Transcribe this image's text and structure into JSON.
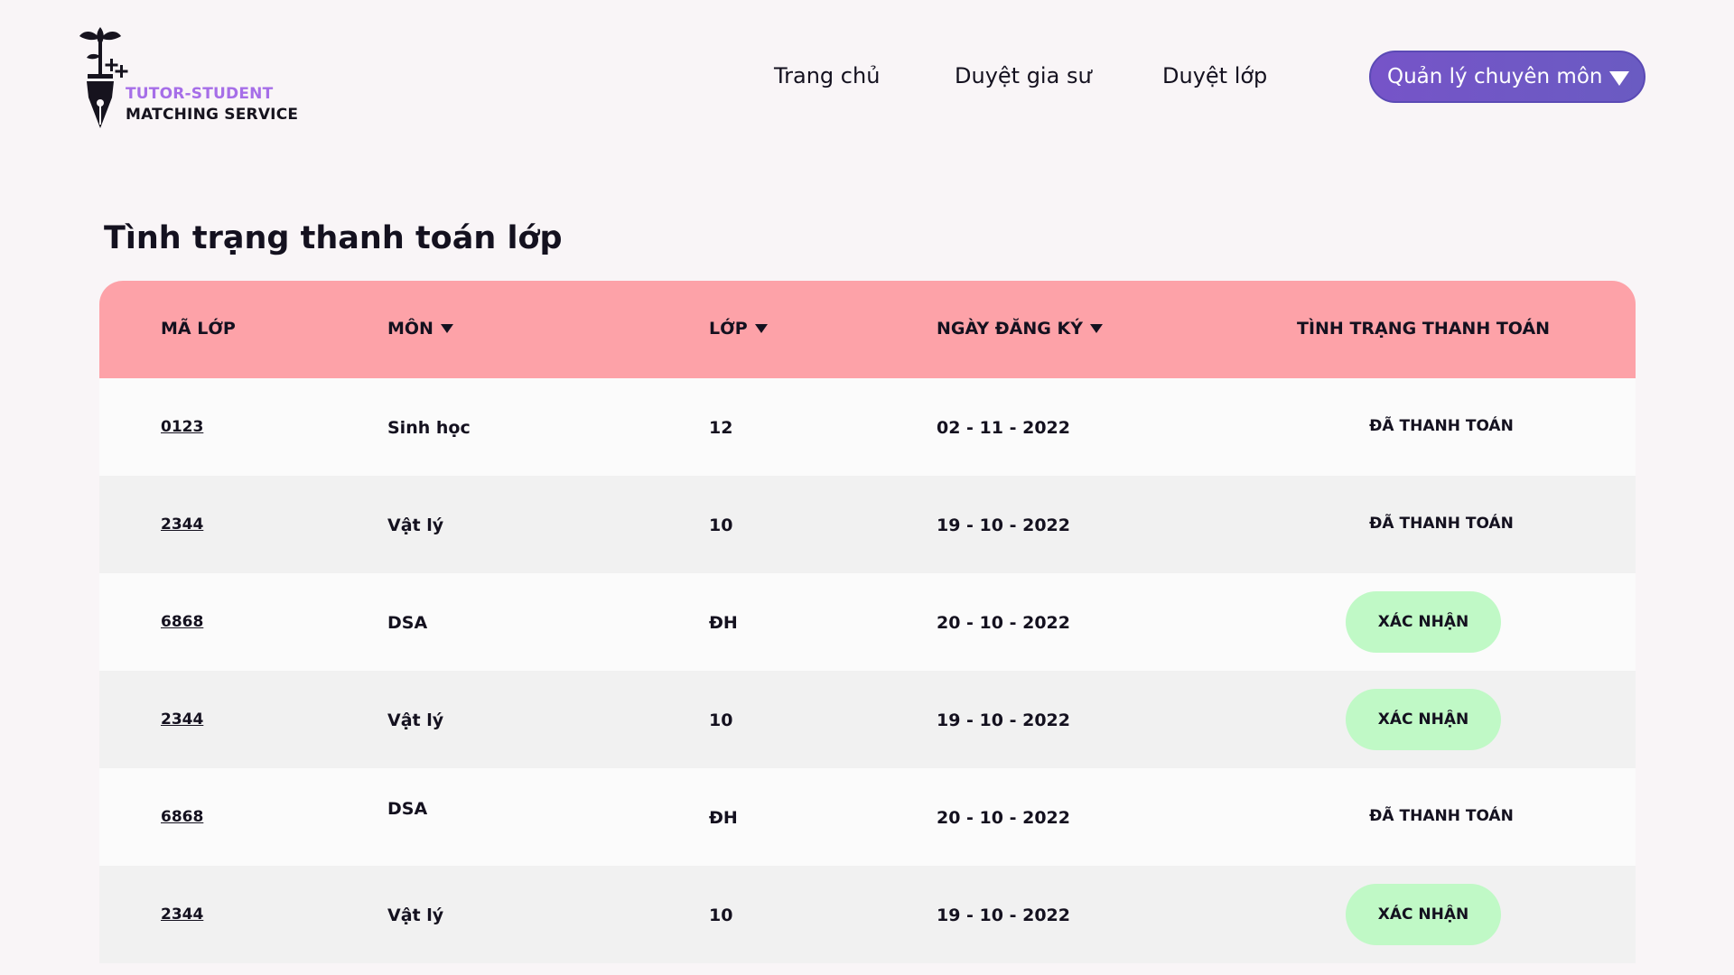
{
  "brand": {
    "line1": "TUTOR-STUDENT",
    "line2": "MATCHING SERVICE",
    "accent_color": "#a66ee8"
  },
  "nav": {
    "home": "Trang chủ",
    "review_tutors": "Duyệt gia sư",
    "review_classes": "Duyệt lớp",
    "manage_label": "Quản lý chuyên môn",
    "manage_color": "#7654c8"
  },
  "page": {
    "title": "Tình trạng thanh toán lớp"
  },
  "table": {
    "header_color": "#fda2a8",
    "columns": {
      "code": "MÃ LỚP",
      "subject": "MÔN",
      "grade": "LỚP",
      "date": "NGÀY ĐĂNG KÝ",
      "status": "TÌNH TRẠNG THANH TOÁN"
    },
    "rows": [
      {
        "code": "0123",
        "subject": "Sinh học",
        "grade": "12",
        "date": "02 - 11 - 2022",
        "status": "ĐÃ THANH TOÁN"
      },
      {
        "code": "2344",
        "subject": "Vật lý",
        "grade": "10",
        "date": "19 -  10 - 2022",
        "status": "ĐÃ THANH TOÁN"
      },
      {
        "code": "6868",
        "subject": "DSA",
        "grade": "ĐH",
        "date": "20 -  10 - 2022",
        "action": "XÁC NHẬN"
      },
      {
        "code": "2344",
        "subject": "Vật lý",
        "grade": "10",
        "date": "19 -  10 - 2022",
        "action": "XÁC NHẬN"
      },
      {
        "code": "6868",
        "subject": "DSA",
        "grade": "ĐH",
        "date": "20 -  10 - 2022",
        "status": "ĐÃ THANH TOÁN"
      },
      {
        "code": "2344",
        "subject": "Vật lý",
        "grade": "10",
        "date": "19 -  10 - 2022",
        "action": "XÁC NHẬN"
      }
    ],
    "confirm_color": "#c0f9c6"
  }
}
